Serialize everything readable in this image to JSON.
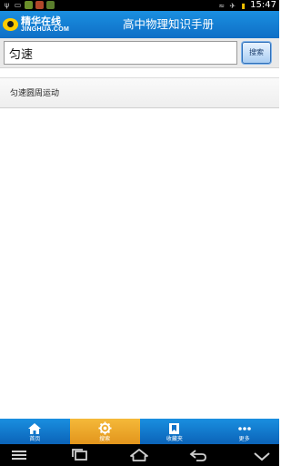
{
  "status_bar": {
    "time": "15:47",
    "left_icons": [
      "usb-icon",
      "screen-icon",
      "app-icon-1",
      "app-icon-2",
      "app-icon-3"
    ],
    "right_icons": [
      "wifi-icon",
      "airplane-icon",
      "battery-icon"
    ]
  },
  "header": {
    "logo_cn": "精华在线",
    "logo_en": "JINGHUA.COM",
    "title": "高中物理知识手册"
  },
  "search": {
    "value": "匀速",
    "button_label": "搜索"
  },
  "results": [
    {
      "label": "匀速圆周运动"
    }
  ],
  "tabs": [
    {
      "label": "首页",
      "icon": "home-icon",
      "active": false
    },
    {
      "label": "搜索",
      "icon": "gear-icon",
      "active": true
    },
    {
      "label": "收藏夹",
      "icon": "bookmark-icon",
      "active": false
    },
    {
      "label": "更多",
      "icon": "more-icon",
      "active": false
    }
  ],
  "colors": {
    "header_blue": "#1a8fe0",
    "tab_active_orange": "#e2951c"
  }
}
